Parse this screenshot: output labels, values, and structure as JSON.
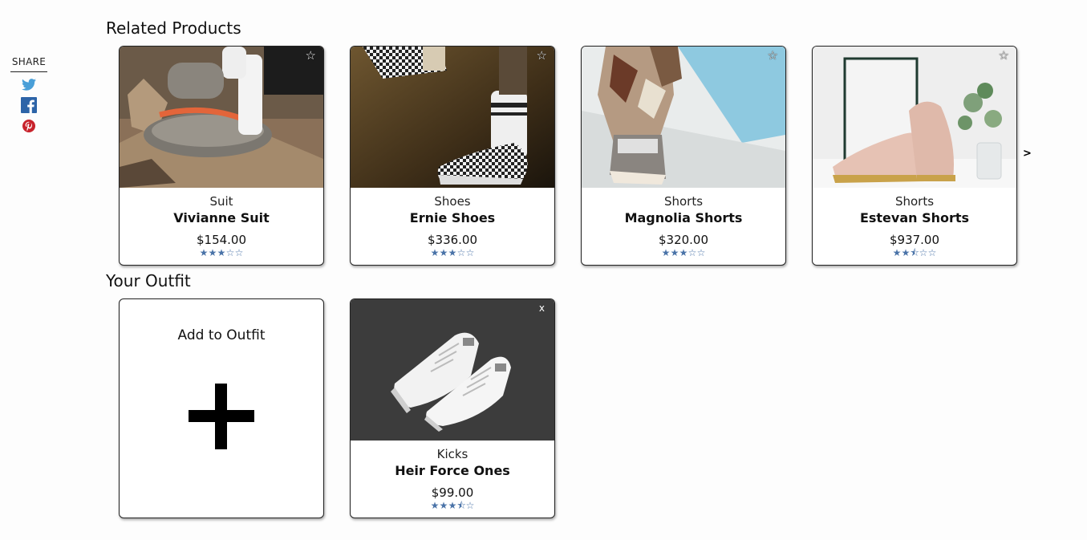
{
  "share": {
    "label": "SHARE",
    "icons": [
      "twitter-icon",
      "facebook-icon",
      "pinterest-icon"
    ],
    "colors": {
      "twitter": "#4a9fd8",
      "facebook": "#2d64a8",
      "pinterest": "#c8232c"
    }
  },
  "related": {
    "title": "Related Products",
    "next_label": ">",
    "star_glyph": "☆",
    "products": [
      {
        "category": "Suit",
        "name": "Vivianne Suit",
        "price": "$154.00",
        "rating": 3,
        "rating_glyphs": [
          "★",
          "★",
          "★",
          "☆",
          "☆"
        ]
      },
      {
        "category": "Shoes",
        "name": "Ernie Shoes",
        "price": "$336.00",
        "rating": 3,
        "rating_glyphs": [
          "★",
          "★",
          "★",
          "☆",
          "☆"
        ]
      },
      {
        "category": "Shorts",
        "name": "Magnolia Shorts",
        "price": "$320.00",
        "rating": 3,
        "rating_glyphs": [
          "★",
          "★",
          "★",
          "☆",
          "☆"
        ]
      },
      {
        "category": "Shorts",
        "name": "Estevan Shorts",
        "price": "$937.00",
        "rating": 2.5,
        "rating_glyphs": [
          "★",
          "★",
          "⯪",
          "☆",
          "☆"
        ]
      }
    ]
  },
  "outfit": {
    "title": "Your Outfit",
    "add_label": "Add to Outfit",
    "close_label": "x",
    "items": [
      {
        "category": "Kicks",
        "name": "Heir Force Ones",
        "price": "$99.00",
        "rating": 3.5,
        "rating_glyphs": [
          "★",
          "★",
          "★",
          "⯪",
          "☆"
        ]
      }
    ]
  },
  "accent_color": "#4a73a8"
}
